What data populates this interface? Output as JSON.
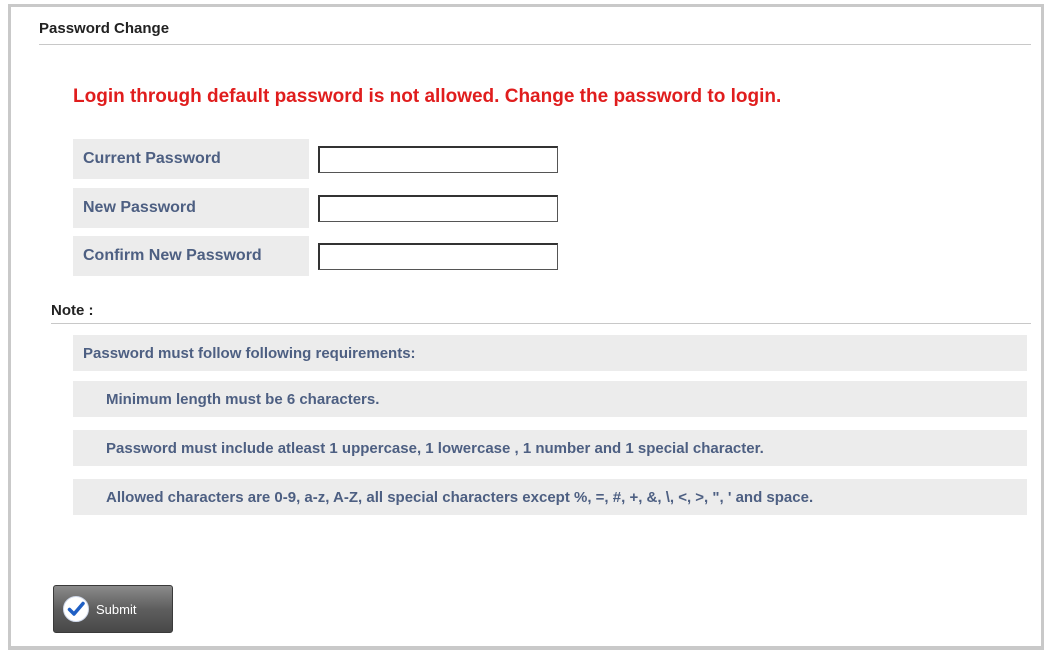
{
  "form": {
    "title": "Password Change",
    "alert": "Login through default password is not allowed. Change the password to login.",
    "fields": [
      {
        "label": "Current Password",
        "value": ""
      },
      {
        "label": "New Password",
        "value": ""
      },
      {
        "label": "Confirm New Password",
        "value": ""
      }
    ]
  },
  "note": {
    "title": "Note :",
    "heading": "Password must follow following requirements:",
    "requirements": [
      "Minimum length must be 6 characters.",
      "Password must include atleast 1 uppercase, 1 lowercase , 1 number and 1 special character.",
      "Allowed characters are 0-9, a-z, A-Z, all special characters except %, =, #, +, &, \\, <, >, \", ' and space."
    ]
  },
  "actions": {
    "submit_label": "Submit",
    "submit_icon": "check-circle-icon"
  },
  "colors": {
    "alert": "#e01d1d",
    "label_text": "#4d5f82",
    "row_background": "#ececec"
  }
}
